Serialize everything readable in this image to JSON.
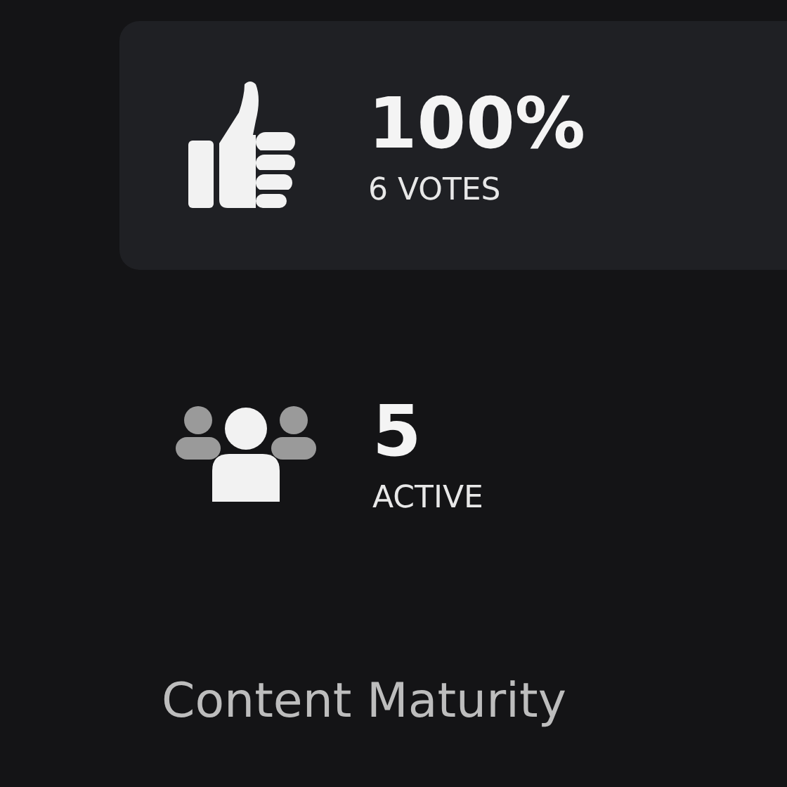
{
  "rating": {
    "value": "100%",
    "votes": "6 VOTES"
  },
  "players": {
    "count": "5",
    "label": "ACTIVE"
  },
  "section_heading": "Content Maturity"
}
